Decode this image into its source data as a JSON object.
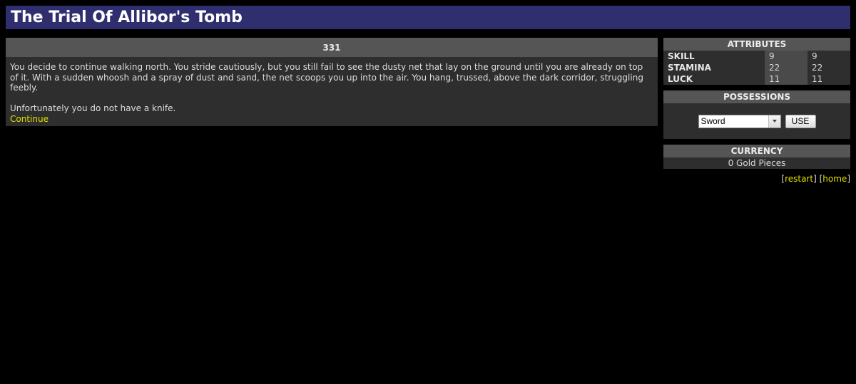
{
  "header": {
    "title": "The Trial Of Allibor's Tomb"
  },
  "main": {
    "section_number": "331",
    "paragraphs": [
      "You decide to continue walking north. You stride cautiously, but you still fail to see the dusty net that lay on the ground until you are already on top of it. With a sudden whoosh and a spray of dust and sand, the net scoops you up into the air. You hang, trussed, above the dark corridor, struggling feebly.",
      "Unfortunately you do not have a knife."
    ],
    "continue_link": "Continue"
  },
  "sidebar": {
    "attributes": {
      "title": "ATTRIBUTES",
      "rows": [
        {
          "name": "SKILL",
          "initial": "9",
          "current": "9"
        },
        {
          "name": "STAMINA",
          "initial": "22",
          "current": "22"
        },
        {
          "name": "LUCK",
          "initial": "11",
          "current": "11"
        }
      ]
    },
    "possessions": {
      "title": "POSSESSIONS",
      "selected_item": "Sword",
      "use_label": "USE"
    },
    "currency": {
      "title": "CURRENCY",
      "value": "0 Gold Pieces"
    },
    "links": {
      "restart": "restart",
      "home": "home"
    }
  },
  "colors": {
    "header_bg": "#2f2f6f",
    "panel_bg": "#2e2e2e",
    "panel_title_bg": "#555555",
    "link": "#e0e000"
  }
}
